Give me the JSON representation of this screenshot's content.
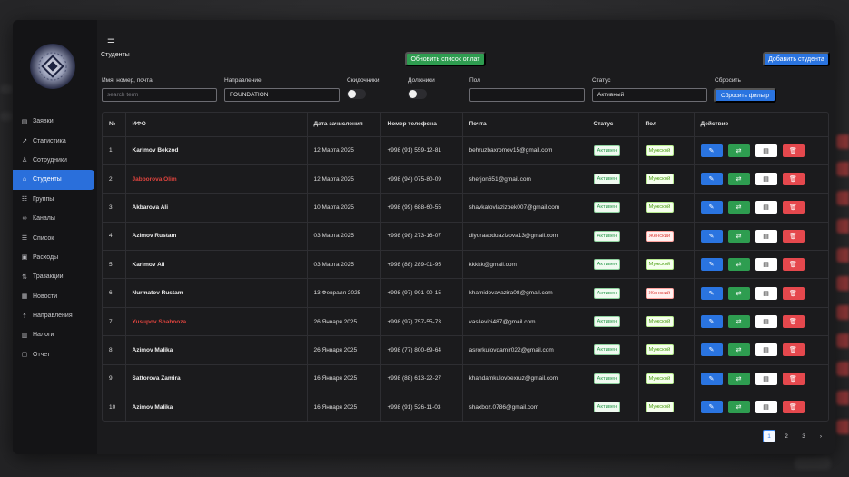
{
  "page_title": "Студенты",
  "buttons": {
    "refresh_payments": "Обновить список оплат",
    "add_student": "Добавить студента",
    "reset_filter": "Сбросить фильтр"
  },
  "filters": {
    "search": {
      "label": "Имя, номер, почта",
      "placeholder": "search term",
      "value": ""
    },
    "direction": {
      "label": "Направление",
      "value": "FOUNDATION"
    },
    "discounts": {
      "label": "Скидочники"
    },
    "debtors": {
      "label": "Должники"
    },
    "gender": {
      "label": "Пол",
      "value": ""
    },
    "status": {
      "label": "Статус",
      "value": "Активный"
    },
    "reset": {
      "label": "Сбросить"
    }
  },
  "sidebar": {
    "items": [
      {
        "label": "Заявки",
        "icon": "clipboard-icon"
      },
      {
        "label": "Статистика",
        "icon": "chart-line-icon"
      },
      {
        "label": "Сотрудники",
        "icon": "users-icon"
      },
      {
        "label": "Студенты",
        "icon": "graduation-cap-icon",
        "active": true
      },
      {
        "label": "Группы",
        "icon": "group-icon"
      },
      {
        "label": "Каналы",
        "icon": "link-icon"
      },
      {
        "label": "Список",
        "icon": "list-icon"
      },
      {
        "label": "Расходы",
        "icon": "wallet-icon"
      },
      {
        "label": "Тразакции",
        "icon": "transaction-icon"
      },
      {
        "label": "Новости",
        "icon": "news-icon"
      },
      {
        "label": "Направления",
        "icon": "direction-icon"
      },
      {
        "label": "Налоги",
        "icon": "tax-icon"
      },
      {
        "label": "Отчет",
        "icon": "report-icon"
      }
    ]
  },
  "table": {
    "headers": [
      "№",
      "ИФО",
      "Дата зачисления",
      "Номер телефона",
      "Почта",
      "Статус",
      "Пол",
      "Действие"
    ],
    "rows": [
      {
        "n": "1",
        "name": "Karimov Bekzod",
        "highlight": false,
        "date": "12 Марта 2025",
        "phone": "+998 (91) 559-12-81",
        "email": "behruzbaxromov15@gmail.com",
        "status": "Активен",
        "gender": "Мужской",
        "gender_type": "male"
      },
      {
        "n": "2",
        "name": "Jabborova Olim",
        "highlight": true,
        "date": "12 Марта 2025",
        "phone": "+998 (94) 075-80-09",
        "email": "sherjon651@gmail.com",
        "status": "Активен",
        "gender": "Мужской",
        "gender_type": "male"
      },
      {
        "n": "3",
        "name": "Akbarova Ali",
        "highlight": false,
        "date": "10 Марта 2025",
        "phone": "+998 (99) 688-60-55",
        "email": "shavkatovlazizbek007@gmail.com",
        "status": "Активен",
        "gender": "Мужской",
        "gender_type": "male"
      },
      {
        "n": "4",
        "name": "Azimov Rustam",
        "highlight": false,
        "date": "03 Марта 2025",
        "phone": "+998 (98) 273-16-07",
        "email": "diyoraabduazizova13@gmail.com",
        "status": "Активен",
        "gender": "Женский",
        "gender_type": "female"
      },
      {
        "n": "5",
        "name": "Karimov Ali",
        "highlight": false,
        "date": "03 Марта 2025",
        "phone": "+998 (88) 289-01-95",
        "email": "kkkkk@gmail.com",
        "status": "Активен",
        "gender": "Мужской",
        "gender_type": "male"
      },
      {
        "n": "6",
        "name": "Nurmatov Rustam",
        "highlight": false,
        "date": "13 Февраля 2025",
        "phone": "+998 (97) 901-00-15",
        "email": "khamidovavazira08@gmail.com",
        "status": "Активен",
        "gender": "Женский",
        "gender_type": "female"
      },
      {
        "n": "7",
        "name": "Yusupov Shahnoza",
        "highlight": true,
        "date": "26 Января 2025",
        "phone": "+998 (97) 757-55-73",
        "email": "vasilevici487@gmail.com",
        "status": "Активен",
        "gender": "Мужской",
        "gender_type": "male"
      },
      {
        "n": "8",
        "name": "Azimov Malika",
        "highlight": false,
        "date": "26 Января 2025",
        "phone": "+998 (77) 800-69-64",
        "email": "asrorkulovdamir022@gmail.com",
        "status": "Активен",
        "gender": "Мужской",
        "gender_type": "male"
      },
      {
        "n": "9",
        "name": "Sattorova Zamira",
        "highlight": false,
        "date": "16 Января 2025",
        "phone": "+998 (88) 613-22-27",
        "email": "khandamkulovbexruz@gmail.com",
        "status": "Активен",
        "gender": "Мужской",
        "gender_type": "male"
      },
      {
        "n": "10",
        "name": "Azimov Malika",
        "highlight": false,
        "date": "16 Января 2025",
        "phone": "+998 (91) 526-11-03",
        "email": "shaxboz.0786@gmail.com",
        "status": "Активен",
        "gender": "Мужской",
        "gender_type": "male"
      }
    ]
  },
  "pagination": {
    "pages": [
      "1",
      "2",
      "3"
    ],
    "current": "1",
    "next": "›"
  },
  "colors": {
    "primary": "#2a74e0",
    "success": "#2e9d50",
    "danger": "#e5484d",
    "sidebar_bg": "#141416",
    "panel_bg": "#1b1b1d"
  }
}
